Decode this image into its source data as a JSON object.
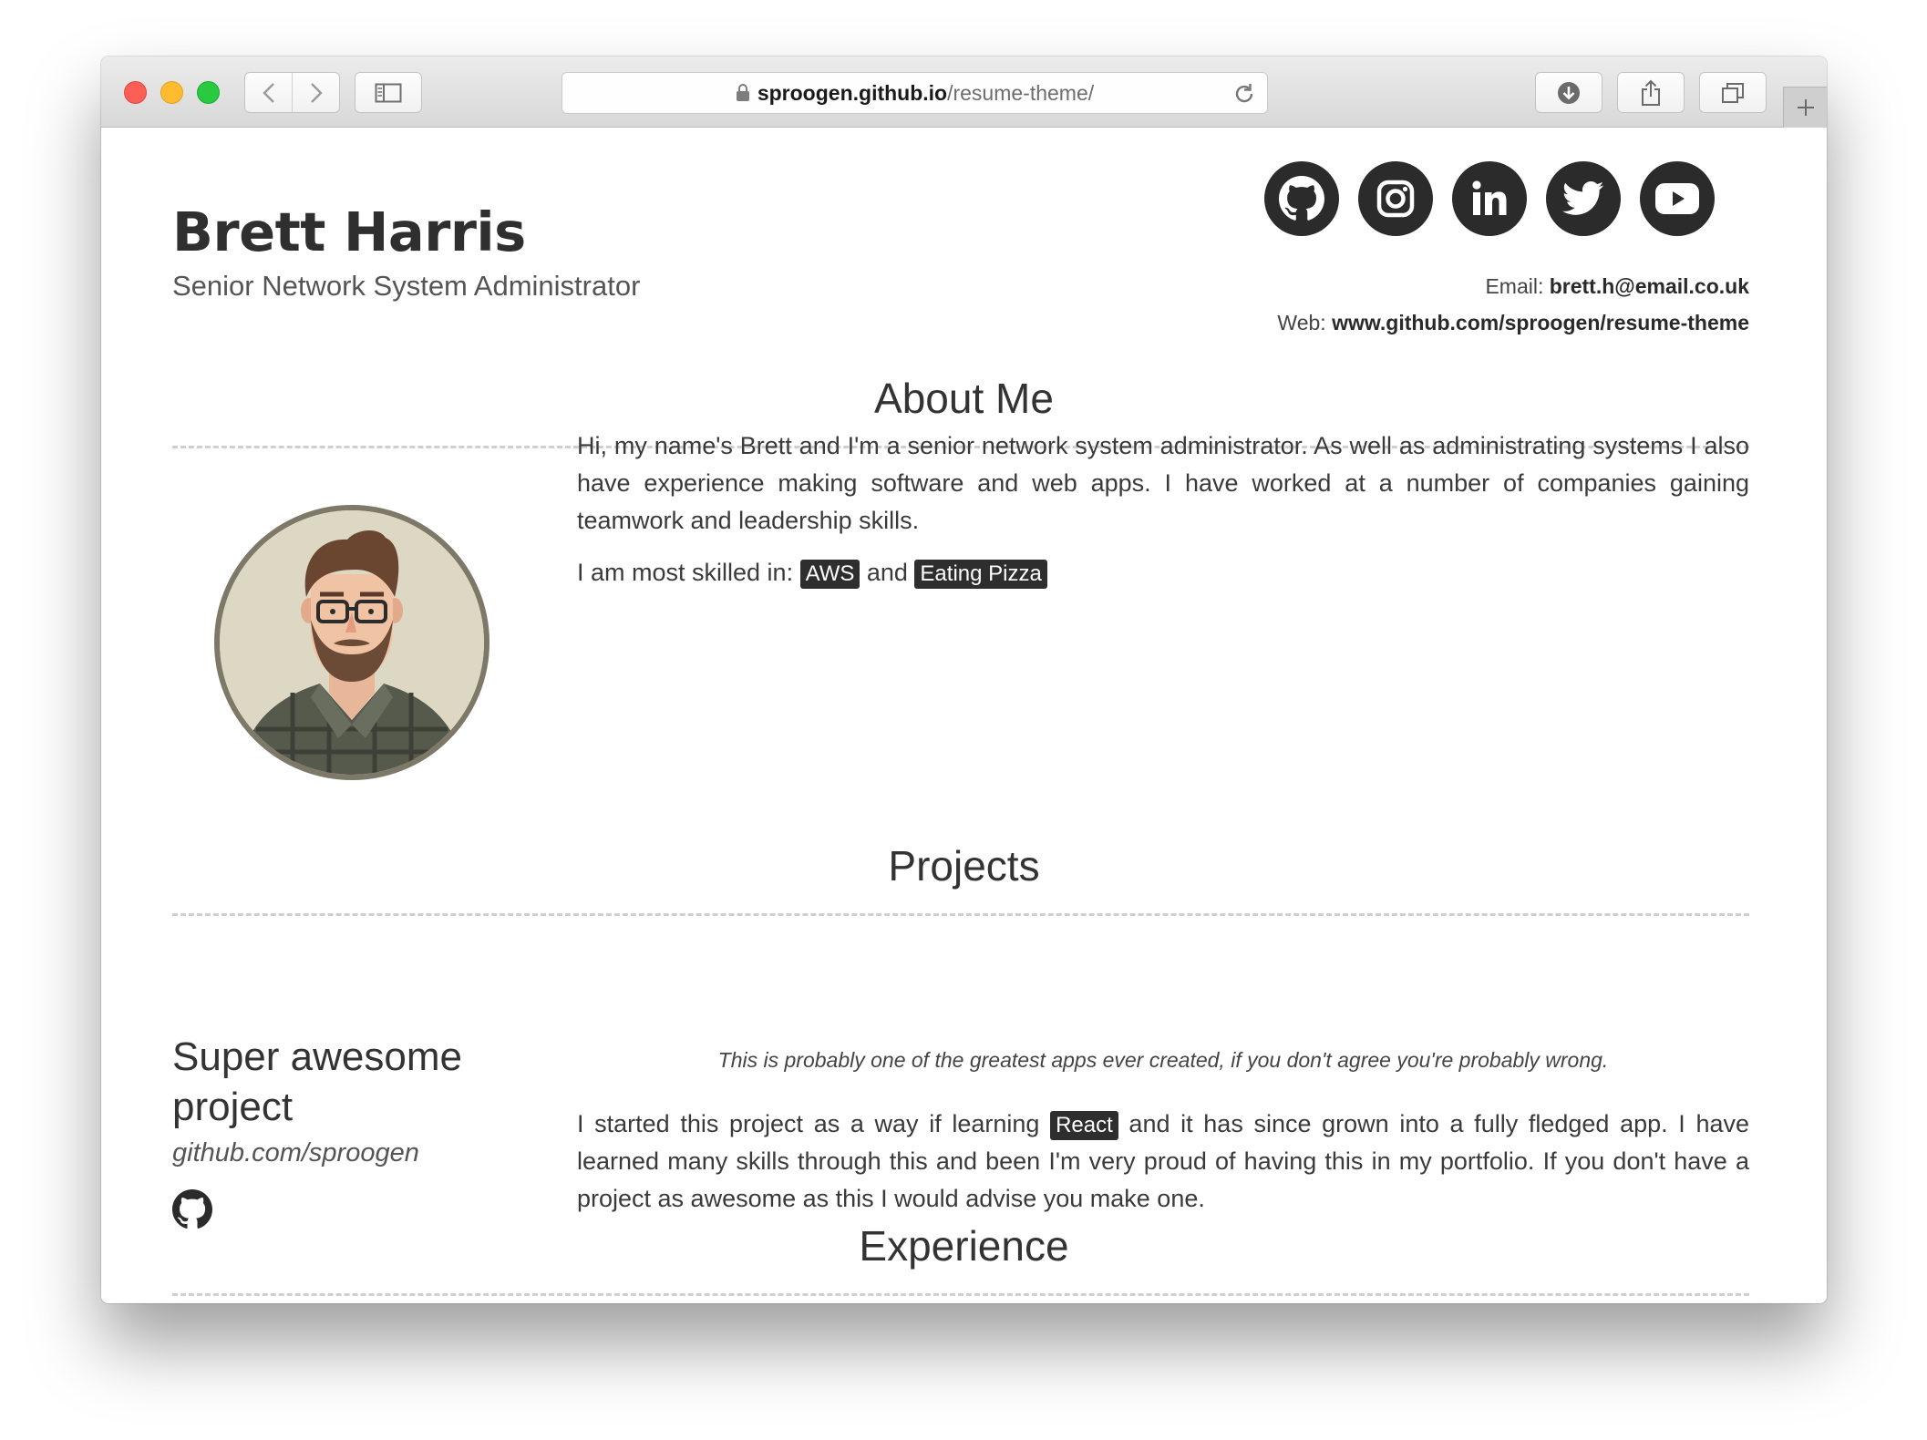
{
  "browser": {
    "url_host": "sproogen.github.io",
    "url_path": "/resume-theme/"
  },
  "header": {
    "name": "Brett Harris",
    "role": "Senior Network System Administrator",
    "socials": [
      "github-icon",
      "instagram-icon",
      "linkedin-icon",
      "twitter-icon",
      "youtube-icon"
    ],
    "email_label": "Email: ",
    "email": "brett.h@email.co.uk",
    "web_label": "Web: ",
    "web": "www.github.com/sproogen/resume-theme"
  },
  "about": {
    "title": "About Me",
    "bio": "Hi, my name's Brett and I'm a senior network system administrator. As well as administrating systems I also have experience making software and web apps. I have worked at a number of companies gaining teamwork and leadership skills.",
    "skills_prefix": "I am most skilled in: ",
    "skill_1": "AWS",
    "skills_join": " and ",
    "skill_2": "Eating Pizza"
  },
  "projects": {
    "title": "Projects",
    "items": [
      {
        "name": "Super awesome project",
        "link": "github.com/sproogen",
        "quote": "This is probably one of the greatest apps ever created, if you don't agree you're probably wrong.",
        "text_1": "I started this project as a way if learning ",
        "tag": "React",
        "text_2": " and it has since grown into a fully fledged app. I have learned many skills through this and been I'm very proud of having this in my portfolio. If you don't have a project as awesome as this I would advise you make one."
      }
    ]
  },
  "experience": {
    "title": "Experience"
  },
  "colors": {
    "tag_bg": "#2e2e2e",
    "social_bg": "#2b2b2b",
    "text": "#333333"
  }
}
